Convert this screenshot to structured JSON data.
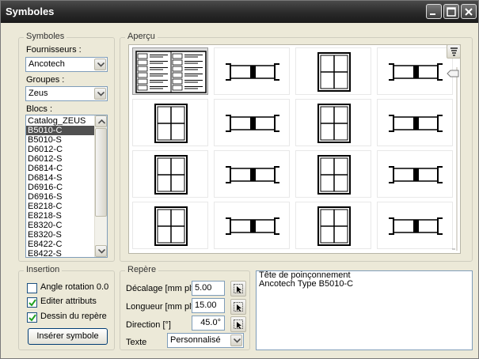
{
  "window": {
    "title": "Symboles"
  },
  "symbols_group": {
    "legend": "Symboles",
    "suppliers_label": "Fournisseurs :",
    "supplier_value": "Ancotech",
    "groups_label": "Groupes :",
    "group_value": "Zeus",
    "blocks_label": "Blocs :",
    "blocks": [
      "Catalog_ZEUS",
      "B5010-C",
      "B5010-S",
      "D6012-C",
      "D6012-S",
      "D6814-C",
      "D6814-S",
      "D6916-C",
      "D6916-S",
      "E8218-C",
      "E8218-S",
      "E8320-C",
      "E8320-S",
      "E8422-C",
      "E8422-S"
    ],
    "selected_block": "B5010-C"
  },
  "preview_group": {
    "legend": "Aperçu",
    "cells": [
      "catalog",
      "section",
      "plan",
      "section",
      "plan",
      "section",
      "plan",
      "section",
      "plan",
      "section",
      "plan",
      "section",
      "plan",
      "section",
      "plan",
      "section"
    ],
    "selected_index": 0
  },
  "insertion_group": {
    "legend": "Insertion",
    "rotation_angle_label": "Angle rotation 0.0",
    "rotation_angle_checked": false,
    "edit_attributes_label": "Editer attributs",
    "edit_attributes_checked": true,
    "draw_marker_label": "Dessin du repère",
    "draw_marker_checked": true,
    "insert_button_label": "Insérer symbole"
  },
  "marker_group": {
    "legend": "Repère",
    "offset_label": "Décalage [mm plt]",
    "offset_value": "5.00",
    "length_label": "Longueur [mm plt]",
    "length_value": "15.00",
    "direction_label": "Direction [°]",
    "direction_value": "45.0°",
    "text_label": "Texte",
    "text_value": "Personnalisé"
  },
  "description": {
    "lines": [
      "Tête de poinçonnement",
      "Ancotech Type B5010-C"
    ]
  },
  "colors": {
    "titlebar": "#2a2a2a",
    "dialog_bg": "#ece9d8",
    "selection": "#505050"
  }
}
